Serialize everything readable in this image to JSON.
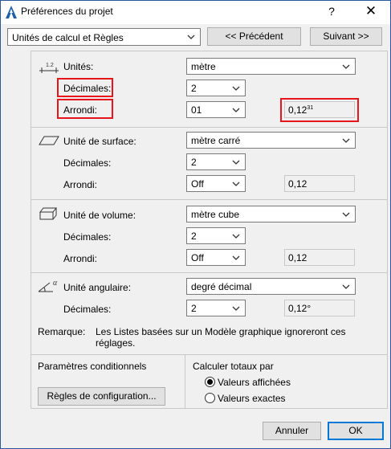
{
  "window": {
    "title": "Préférences du projet",
    "help_label": "?",
    "close_label": "✕"
  },
  "top": {
    "category_value": "Unités de calcul et Règles",
    "prev_label": "<< Précédent",
    "next_label": "Suivant >>"
  },
  "units": {
    "icon_text": "1.2",
    "label": "Unités:",
    "unit_value": "mètre",
    "decimals_label": "Décimales:",
    "decimals_value": "2",
    "rounding_label": "Arrondi:",
    "rounding_value": "01",
    "preview_value": "0,12",
    "preview_sup": "31"
  },
  "surface": {
    "label": "Unité de surface:",
    "unit_value": "mètre carré",
    "decimals_label": "Décimales:",
    "decimals_value": "2",
    "rounding_label": "Arrondi:",
    "rounding_value": "Off",
    "preview_value": "0,12"
  },
  "volume": {
    "label": "Unité de volume:",
    "unit_value": "mètre cube",
    "decimals_label": "Décimales:",
    "decimals_value": "2",
    "rounding_label": "Arrondi:",
    "rounding_value": "Off",
    "preview_value": "0,12"
  },
  "angular": {
    "icon_text": "α",
    "label": "Unité angulaire:",
    "unit_value": "degré décimal",
    "decimals_label": "Décimales:",
    "decimals_value": "2",
    "preview_value": "0,12°"
  },
  "remark": {
    "label": "Remarque:",
    "text_line1": "Les Listes basées sur un Modèle graphique ignoreront ces",
    "text_line2": "réglages."
  },
  "conditional": {
    "label": "Paramètres conditionnels",
    "config_button": "Règles de configuration..."
  },
  "totals": {
    "label": "Calculer totaux par",
    "option_displayed": "Valeurs affichées",
    "option_exact": "Valeurs exactes",
    "selected": "Valeurs affichées"
  },
  "footer": {
    "cancel_label": "Annuler",
    "ok_label": "OK"
  },
  "colors": {
    "highlight": "#e8141c",
    "focus_border": "#0078d7"
  }
}
